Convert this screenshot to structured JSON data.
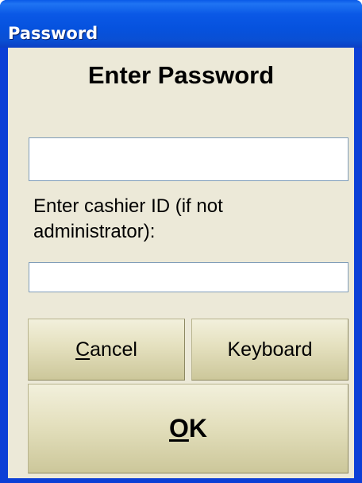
{
  "window": {
    "title": "Password"
  },
  "dialog": {
    "heading": "Enter Password",
    "password_field": {
      "value": "",
      "placeholder": ""
    },
    "cashier_label": "Enter cashier ID (if not administrator):",
    "cashier_field": {
      "value": "",
      "placeholder": ""
    }
  },
  "buttons": {
    "cancel": {
      "accel": "C",
      "rest": "ancel"
    },
    "keyboard": {
      "label": "Keyboard"
    },
    "ok": {
      "accel": "O",
      "rest": "K"
    }
  },
  "colors": {
    "titlebar": "#0a58e6",
    "dialog_background": "#ece9d8",
    "button_face": "#e4e0be"
  }
}
